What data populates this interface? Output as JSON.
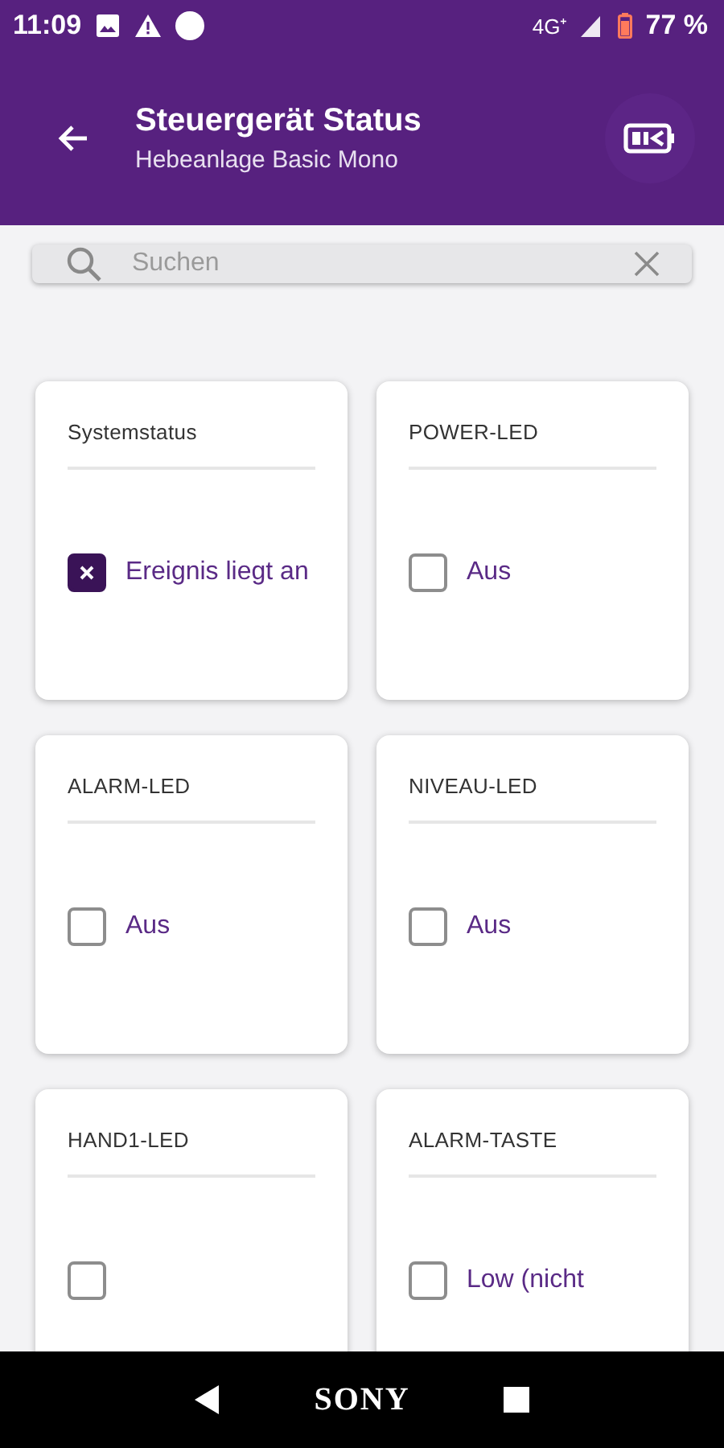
{
  "status_bar": {
    "time": "11:09",
    "network": "4G⁺",
    "battery": "77 %"
  },
  "app_bar": {
    "title": "Steuergerät Status",
    "subtitle": "Hebeanlage Basic Mono"
  },
  "search": {
    "placeholder": "Suchen"
  },
  "cards": [
    {
      "title": "Systemstatus",
      "checked": true,
      "value": "Ereignis liegt an"
    },
    {
      "title": "POWER-LED",
      "checked": false,
      "value": "Aus"
    },
    {
      "title": "ALARM-LED",
      "checked": false,
      "value": "Aus"
    },
    {
      "title": "NIVEAU-LED",
      "checked": false,
      "value": "Aus"
    },
    {
      "title": "HAND1-LED",
      "checked": false
    },
    {
      "title": "ALARM-TASTE",
      "checked": false,
      "value": "Low (nicht"
    }
  ],
  "nav_bar": {
    "brand": "SONY"
  }
}
